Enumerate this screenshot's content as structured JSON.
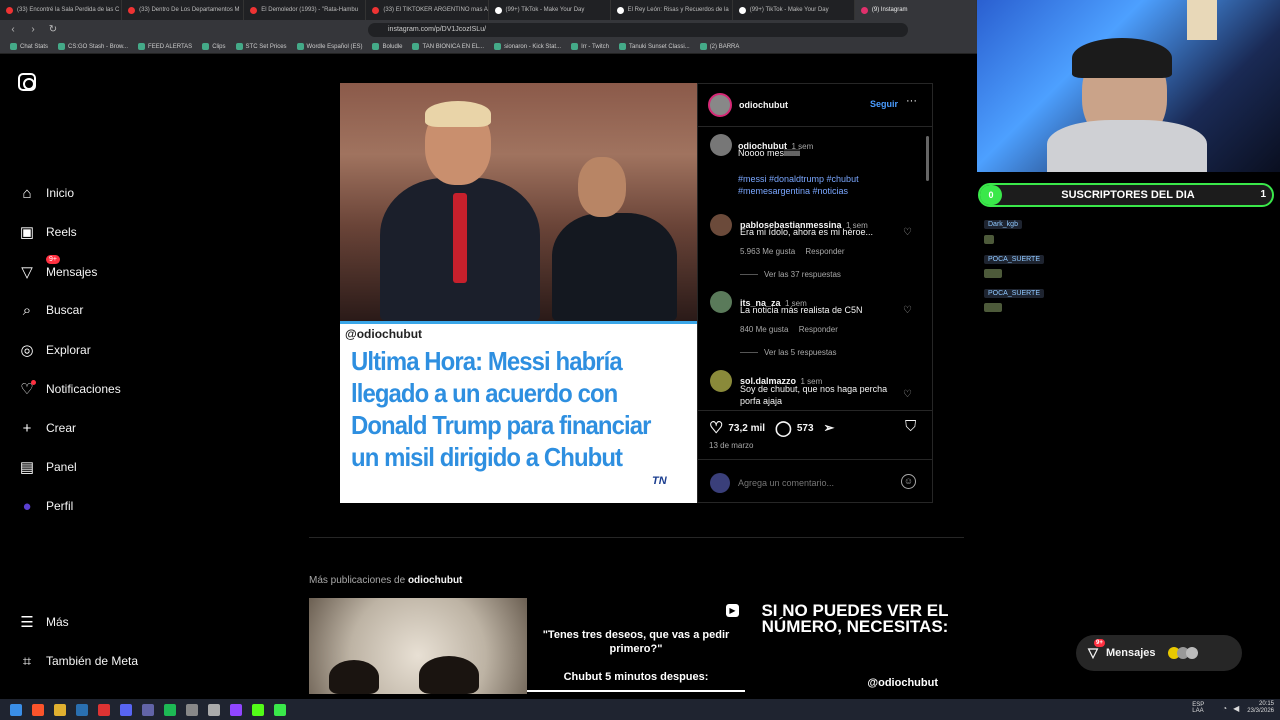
{
  "browser": {
    "tabs": [
      {
        "label": "(33) Encontré la Sala Perdida de las C",
        "color": "#e33"
      },
      {
        "label": "(33) Dentro De Los Departamentos M",
        "color": "#e33"
      },
      {
        "label": "El Demoledor (1993) - \"Rata-Hambu",
        "color": "#e33"
      },
      {
        "label": "(33) El TIKTOKER ARGENTINO mas A",
        "color": "#e33"
      },
      {
        "label": "(99+) TikTok - Make Your Day",
        "color": "#fff"
      },
      {
        "label": "El Rey León: Risas y Recuerdos de la",
        "color": "#fff"
      },
      {
        "label": "(99+) TikTok - Make Your Day",
        "color": "#fff"
      },
      {
        "label": "(9) Instagram",
        "color": "#e1306c"
      }
    ],
    "url": "instagram.com/p/DV1JcozISLu/",
    "bookmarks": [
      "Chat Stats",
      "CS:GO Stash - Brow...",
      "FEED ALERTAS",
      "Clips",
      "STC Set Prices",
      "Wordle Español (ES)",
      "Boludle",
      "TAN BIONICA EN EL...",
      "sionaron - Kick Stat...",
      "Irr - Twitch",
      "Tanuki Sunset Classi...",
      "(2) BARRA"
    ]
  },
  "sidebar": {
    "items": [
      {
        "label": "Inicio",
        "icon": "home-icon"
      },
      {
        "label": "Reels",
        "icon": "reels-icon"
      },
      {
        "label": "Mensajes",
        "icon": "messenger-icon",
        "badge": "9+"
      },
      {
        "label": "Buscar",
        "icon": "search-icon"
      },
      {
        "label": "Explorar",
        "icon": "compass-icon"
      },
      {
        "label": "Notificaciones",
        "icon": "heart-icon"
      },
      {
        "label": "Crear",
        "icon": "plus-icon"
      },
      {
        "label": "Panel",
        "icon": "dashboard-icon"
      },
      {
        "label": "Perfil",
        "icon": "avatar"
      }
    ],
    "more": "Más",
    "meta": "También de Meta"
  },
  "post": {
    "watermark": "@odiochubut",
    "headline": "Ultima Hora: Messi habría llegado a un acuerdo con Donald Trump para financiar un misil dirigido a Chubut",
    "source_logo": "TN",
    "author": "odiochubut",
    "follow": "Seguir",
    "caption_author": "odiochubut",
    "caption_time": "1 sem",
    "caption_text": "Noooo mesiiiiiiii",
    "hashtags": "#messi #donaldtrump #chubut #memesargentina #noticias",
    "comments": [
      {
        "user": "pablosebastianmessina",
        "time": "1 sem",
        "text": "Era mi ídolo, ahora es mi héroe...",
        "likes": "5.963 Me gusta",
        "reply": "Responder",
        "more": "Ver las 37 respuestas"
      },
      {
        "user": "its_na_za",
        "time": "1 sem",
        "text": "La noticia más realista de C5N",
        "likes": "840 Me gusta",
        "reply": "Responder",
        "more": "Ver las 5 respuestas"
      },
      {
        "user": "sol.dalmazzo",
        "time": "1 sem",
        "text": "Soy de chubut, que nos haga percha porfa ajaja"
      }
    ],
    "likes": "73,2 mil",
    "comment_count": "573",
    "date": "13 de marzo",
    "comment_placeholder": "Agrega un comentario..."
  },
  "more_posts": {
    "label": "Más publicaciones de",
    "user": "odiochubut",
    "thumb2_line1": "\"Tenes tres deseos, que vas a pedir primero?\"",
    "thumb2_line2": "Chubut 5 minutos despues:",
    "thumb3_text": "SI NO PUEDES VER EL NÚMERO, NECESITAS:",
    "thumb3_handle": "@odiochubut"
  },
  "stream": {
    "subs_left": "0",
    "subs_title": "SUSCRIPTORES DEL DIA",
    "subs_right": "1",
    "chat": [
      "Dark_kgb",
      "POCA_SUERTE",
      "POCA_SUERTE"
    ]
  },
  "messages_pill": {
    "label": "Mensajes",
    "badge": "9+"
  },
  "tray": {
    "lang": "ESP LAA",
    "time": "20:15",
    "date": "23/3/2026"
  }
}
